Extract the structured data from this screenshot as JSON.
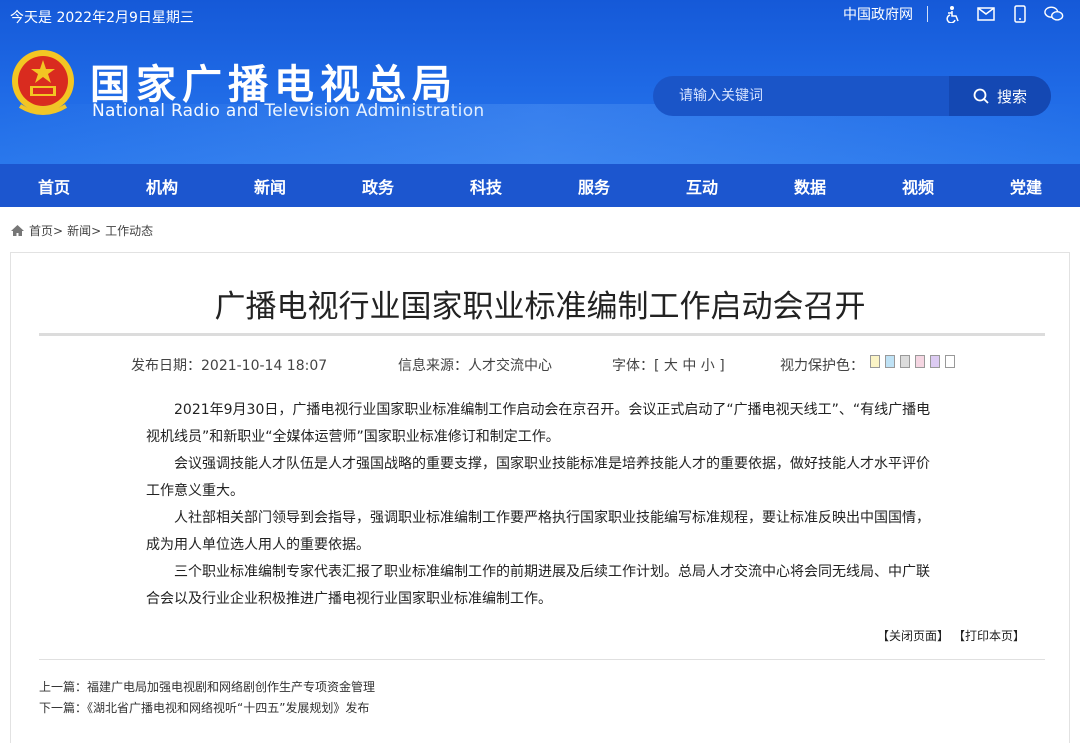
{
  "topbar": {
    "today": "今天是 2022年2月9日星期三",
    "gov_link": "中国政府网",
    "icons": [
      "accessibility-icon",
      "mail-icon",
      "mobile-icon",
      "wechat-icon"
    ]
  },
  "header": {
    "title": "国家广播电视总局",
    "subtitle": "National Radio and Television Administration",
    "brand_color": "#1c56cf"
  },
  "search": {
    "placeholder": "请输入关键词",
    "button": "搜索"
  },
  "nav": [
    "首页",
    "机构",
    "新闻",
    "政务",
    "科技",
    "服务",
    "互动",
    "数据",
    "视频",
    "党建"
  ],
  "breadcrumb": [
    "首页>",
    "新闻>",
    "工作动态"
  ],
  "article": {
    "title": "广播电视行业国家职业标准编制工作启动会召开",
    "publish_date": "发布日期：2021-10-14 18:07",
    "source": "信息来源：人才交流中心",
    "font_size": "字体：[ 大 中 小 ]",
    "eye_care": "视力保护色：",
    "eye_colors": [
      "#fbf4c6",
      "#bfe2f5",
      "#dcdcdc",
      "#f5d6e2",
      "#dccbf2",
      "#ffffff"
    ],
    "paragraphs": [
      "2021年9月30日，广播电视行业国家职业标准编制工作启动会在京召开。会议正式启动了“广播电视天线工”、“有线广播电视机线员”和新职业“全媒体运营师”国家职业标准修订和制定工作。",
      "会议强调技能人才队伍是人才强国战略的重要支撑，国家职业技能标准是培养技能人才的重要依据，做好技能人才水平评价工作意义重大。",
      "人社部相关部门领导到会指导，强调职业标准编制工作要严格执行国家职业技能编写标准规程，要让标准反映出中国国情，成为用人单位选人用人的重要依据。",
      "三个职业标准编制专家代表汇报了职业标准编制工作的前期进展及后续工作计划。总局人才交流中心将会同无线局、中广联合会以及行业企业积极推进广播电视行业国家职业标准编制工作。"
    ],
    "close_page": "【关闭页面】",
    "print_page": "【打印本页】",
    "prev": "上一篇：福建广电局加强电视剧和网络剧创作生产专项资金管理",
    "next": "下一篇：《湖北省广播电视和网络视听“十四五”发展规划》发布"
  }
}
